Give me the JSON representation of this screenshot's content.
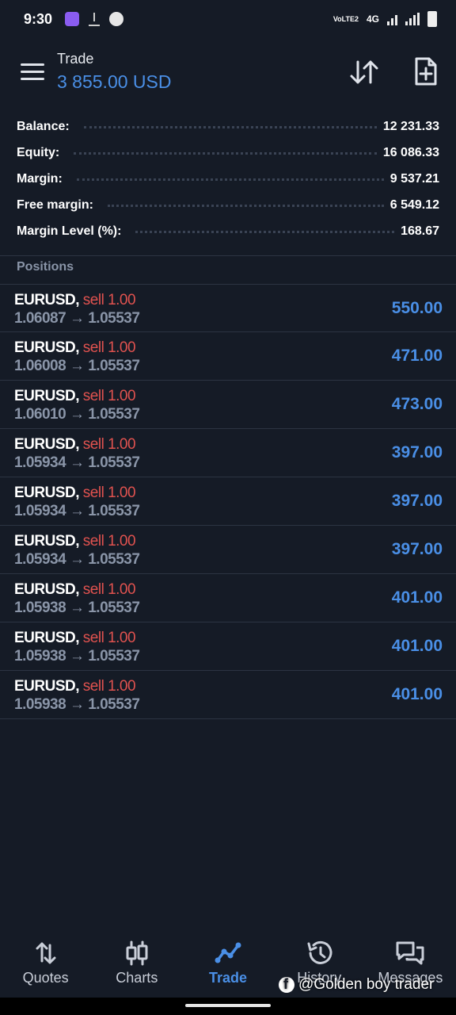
{
  "status_bar": {
    "time": "9:30",
    "network": "4G",
    "volte": "VoLTE2"
  },
  "header": {
    "title": "Trade",
    "amount": "3 855.00 USD"
  },
  "account": [
    {
      "label": "Balance:",
      "value": "12 231.33"
    },
    {
      "label": "Equity:",
      "value": "16 086.33"
    },
    {
      "label": "Margin:",
      "value": "9 537.21"
    },
    {
      "label": "Free margin:",
      "value": "6 549.12"
    },
    {
      "label": "Margin Level (%):",
      "value": "168.67"
    }
  ],
  "positions_header": "Positions",
  "positions": [
    {
      "symbol": "EURUSD,",
      "side": "sell 1.00",
      "prices": "1.06087 → 1.05537",
      "profit": "550.00"
    },
    {
      "symbol": "EURUSD,",
      "side": "sell 1.00",
      "prices": "1.06008 → 1.05537",
      "profit": "471.00"
    },
    {
      "symbol": "EURUSD,",
      "side": "sell 1.00",
      "prices": "1.06010 → 1.05537",
      "profit": "473.00"
    },
    {
      "symbol": "EURUSD,",
      "side": "sell 1.00",
      "prices": "1.05934 → 1.05537",
      "profit": "397.00"
    },
    {
      "symbol": "EURUSD,",
      "side": "sell 1.00",
      "prices": "1.05934 → 1.05537",
      "profit": "397.00"
    },
    {
      "symbol": "EURUSD,",
      "side": "sell 1.00",
      "prices": "1.05934 → 1.05537",
      "profit": "397.00"
    },
    {
      "symbol": "EURUSD,",
      "side": "sell 1.00",
      "prices": "1.05938 → 1.05537",
      "profit": "401.00"
    },
    {
      "symbol": "EURUSD,",
      "side": "sell 1.00",
      "prices": "1.05938 → 1.05537",
      "profit": "401.00"
    },
    {
      "symbol": "EURUSD,",
      "side": "sell 1.00",
      "prices": "1.05938 → 1.05537",
      "profit": "401.00"
    }
  ],
  "bottom_nav": [
    {
      "label": "Quotes",
      "icon": "quotes-arrows-icon",
      "active": false
    },
    {
      "label": "Charts",
      "icon": "candlestick-icon",
      "active": false
    },
    {
      "label": "Trade",
      "icon": "trade-line-icon",
      "active": true
    },
    {
      "label": "History",
      "icon": "history-icon",
      "active": false
    },
    {
      "label": "Messages",
      "icon": "messages-icon",
      "active": false
    }
  ],
  "watermark": "@Golden boy trader",
  "colors": {
    "background": "#151b26",
    "accent_blue": "#4a8fe6",
    "sell_red": "#e0524f",
    "muted_gray": "#8a95a8"
  }
}
